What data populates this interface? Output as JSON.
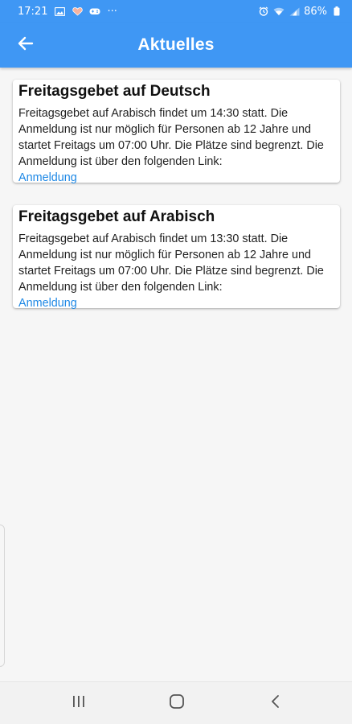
{
  "status_bar": {
    "time": "17:21",
    "left_icons": [
      "image-icon",
      "heart-shield-icon",
      "game-controller-icon"
    ],
    "more": "···",
    "right_icons": [
      "alarm-icon",
      "wifi-icon",
      "signal-icon"
    ],
    "battery": "86%"
  },
  "app_bar": {
    "title": "Aktuelles",
    "back_icon": "arrow-left-icon"
  },
  "cards": [
    {
      "title": "Freitagsgebet auf Deutsch",
      "body": "Freitagsgebet auf Arabisch findet um 14:30 statt. Die Anmeldung ist nur möglich für Personen ab 12 Jahre und startet Freitags um 07:00 Uhr. Die Plätze sind begrenzt. Die Anmeldung ist über den folgenden Link:",
      "link": "Anmeldung"
    },
    {
      "title": "Freitagsgebet auf Arabisch",
      "body": "Freitagsgebet auf Arabisch findet um 13:30 statt. Die Anmeldung ist nur möglich für Personen ab 12 Jahre und startet Freitags um 07:00 Uhr. Die Plätze sind begrenzt. Die Anmeldung ist über den folgenden Link:",
      "link": "Anmeldung"
    }
  ],
  "nav_bar": {
    "recents_icon": "recents-icon",
    "home_icon": "home-icon",
    "back_icon": "back-chevron-icon"
  },
  "colors": {
    "primary": "#3f97f4",
    "link": "#1e88e5",
    "background": "#f6f6f6"
  }
}
